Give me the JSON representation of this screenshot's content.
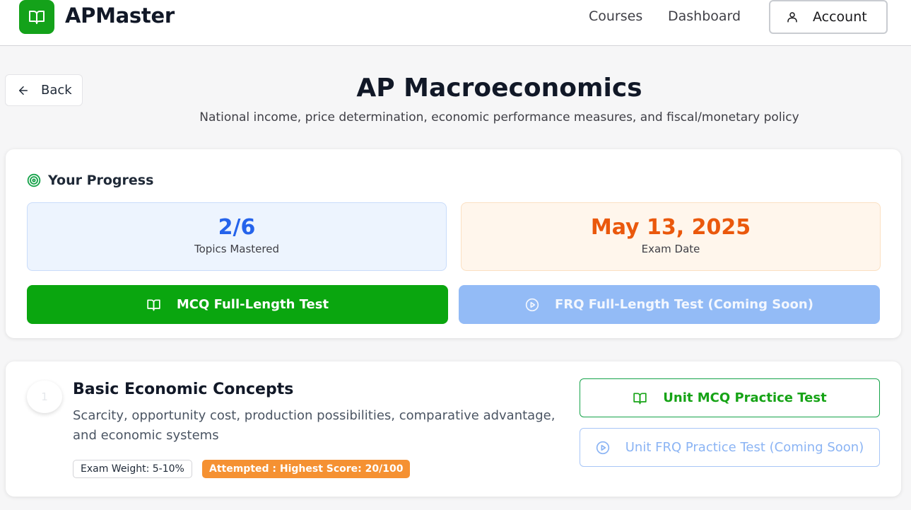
{
  "header": {
    "brand": "APMaster",
    "nav": {
      "courses": "Courses",
      "dashboard": "Dashboard"
    },
    "account_label": "Account"
  },
  "page": {
    "back_label": "Back",
    "title": "AP Macroeconomics",
    "subtitle": "National income, price determination, economic performance measures, and fiscal/monetary policy"
  },
  "progress": {
    "heading": "Your Progress",
    "topics_value": "2/6",
    "topics_label": "Topics Mastered",
    "exam_value": "May 13, 2025",
    "exam_label": "Exam Date",
    "mcq_button": "MCQ Full-Length Test",
    "frq_button": "FRQ Full-Length Test (Coming Soon)"
  },
  "unit": {
    "number": "1",
    "title": "Basic Economic Concepts",
    "description": "Scarcity, opportunity cost, production possibilities, comparative advantage, and economic systems",
    "weight_badge": "Exam Weight: 5-10%",
    "score_badge": "Attempted : Highest Score: 20/100",
    "mcq_button": "Unit MCQ Practice Test",
    "frq_button": "Unit FRQ Practice Test (Coming Soon)"
  },
  "colors": {
    "brand_green": "#14a21a",
    "topics_blue": "#2563eb",
    "exam_orange": "#ea580c",
    "frq_disabled_blue": "#93bbf6",
    "score_badge_orange": "#f59132"
  },
  "icons": [
    "book-open-icon",
    "user-icon",
    "arrow-left-icon",
    "target-icon",
    "play-circle-icon"
  ]
}
